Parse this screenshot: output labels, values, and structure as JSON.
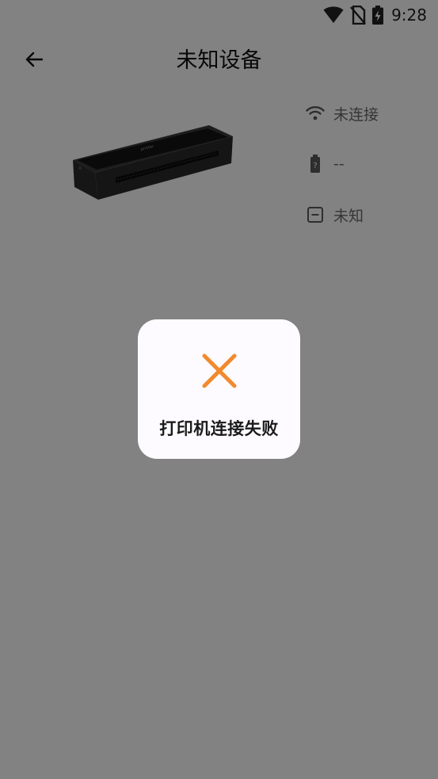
{
  "status_bar": {
    "time": "9:28"
  },
  "toolbar": {
    "title": "未知设备"
  },
  "device": {
    "image_label": "printer",
    "info": [
      {
        "icon": "wifi-icon",
        "text": "未连接"
      },
      {
        "icon": "battery-icon",
        "text": "--"
      },
      {
        "icon": "status-box-icon",
        "text": "未知"
      }
    ]
  },
  "dialog": {
    "icon": "close-x-icon",
    "icon_color": "#F28A2E",
    "message": "打印机连接失败"
  }
}
